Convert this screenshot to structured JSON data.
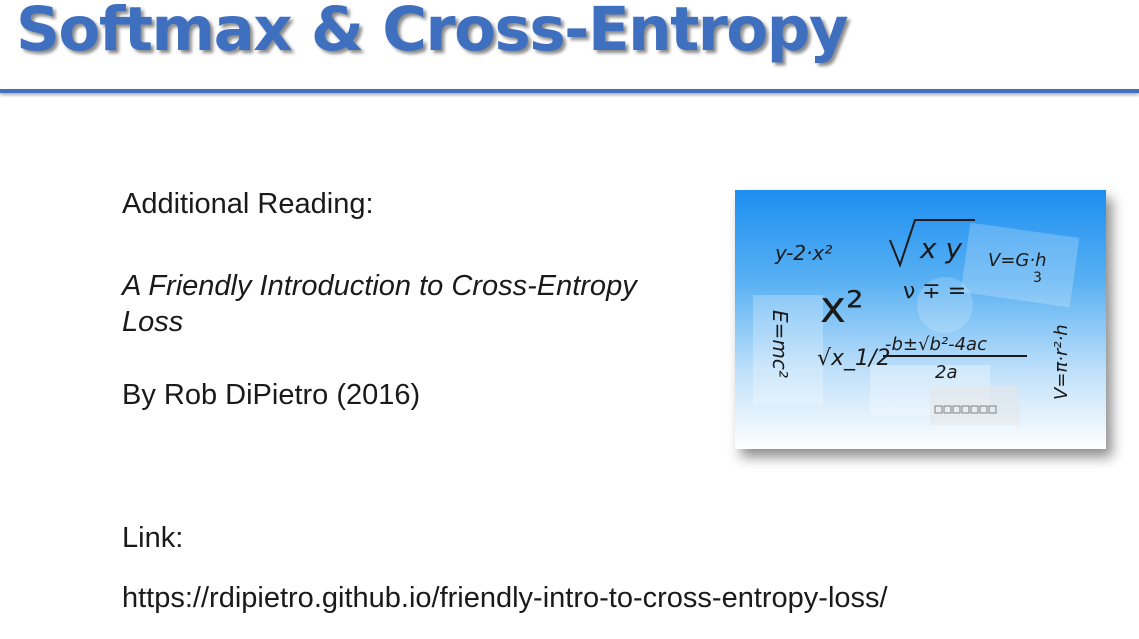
{
  "slide": {
    "title": "Softmax & Cross-Entropy",
    "heading": "Additional Reading:",
    "article_title": "A Friendly Introduction to Cross-Entropy Loss",
    "author_line": "By Rob DiPietro (2016)",
    "link_label": "Link:",
    "link_url": "https://rdipietro.github.io/friendly-intro-to-cross-entropy-loss/"
  },
  "math_image": {
    "eq_1": "y-2·x²",
    "eq_2": "x²",
    "eq_3": "V=G·h",
    "eq_4": "3",
    "eq_5": "-b±√b²-4ac",
    "eq_6": "2a",
    "eq_7": "√x_1/2",
    "eq_8": "E=mc²",
    "eq_9": "V=π·r²·h"
  },
  "colors": {
    "accent": "#3f6fbf",
    "image_sky_top": "#1d8ff0",
    "image_sky_bottom": "#ffffff"
  }
}
